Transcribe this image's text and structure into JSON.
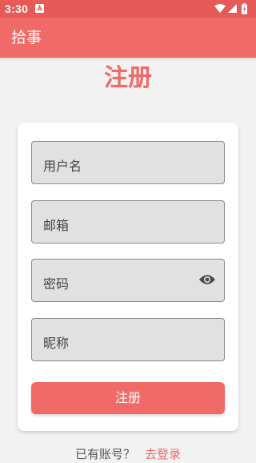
{
  "status_bar": {
    "time": "3:30",
    "notification_icon": "a-notification-icon",
    "icons": [
      "wifi-icon",
      "cell-signal-icon",
      "battery-icon"
    ]
  },
  "app_bar": {
    "title": "拾事"
  },
  "page": {
    "heading": "注册"
  },
  "form": {
    "fields": [
      {
        "label": "用户名"
      },
      {
        "label": "邮箱"
      },
      {
        "label": "密码",
        "trailing_icon": "eye-icon"
      },
      {
        "label": "昵称"
      }
    ],
    "submit_label": "注册"
  },
  "footer": {
    "question": "已有账号？",
    "link": "去登录"
  },
  "colors": {
    "primary": "#f06b68",
    "status_bar": "#e65a57",
    "field_bg": "#e1e1e1",
    "background": "#f2f2f2"
  }
}
